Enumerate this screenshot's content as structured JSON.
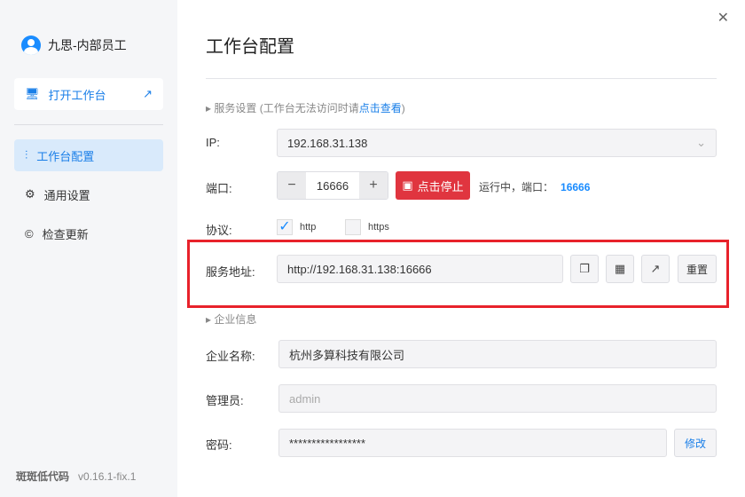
{
  "sidebar": {
    "user": "九思-内部员工",
    "open_label": "打开工作台",
    "items": [
      {
        "label": "工作台配置"
      },
      {
        "label": "通用设置"
      },
      {
        "label": "检查更新"
      }
    ],
    "brand": "斑斑低代码",
    "version": "v0.16.1-fix.1"
  },
  "main": {
    "title": "工作台配置",
    "service": {
      "heading": "服务设置",
      "hint_prefix": "(工作台无法访问时请",
      "hint_link": "点击查看",
      "hint_suffix": ")",
      "ip_label": "IP:",
      "ip_value": "192.168.31.138",
      "port_label": "端口:",
      "port_value": "16666",
      "minus": "−",
      "plus": "+",
      "stop_label": "点击停止",
      "status_text": "运行中，端口：",
      "status_port": "16666",
      "protocol_label": "协议:",
      "protocols": [
        {
          "label": "http",
          "checked": true
        },
        {
          "label": "https",
          "checked": false
        }
      ],
      "address_label": "服务地址:",
      "address_value": "http://192.168.31.138:16666",
      "reset_label": "重置"
    },
    "company": {
      "heading": "企业信息",
      "name_label": "企业名称:",
      "name_value": "杭州多算科技有限公司",
      "admin_label": "管理员:",
      "admin_value": "admin",
      "password_label": "密码:",
      "password_value": "*****************",
      "edit_label": "修改"
    }
  }
}
